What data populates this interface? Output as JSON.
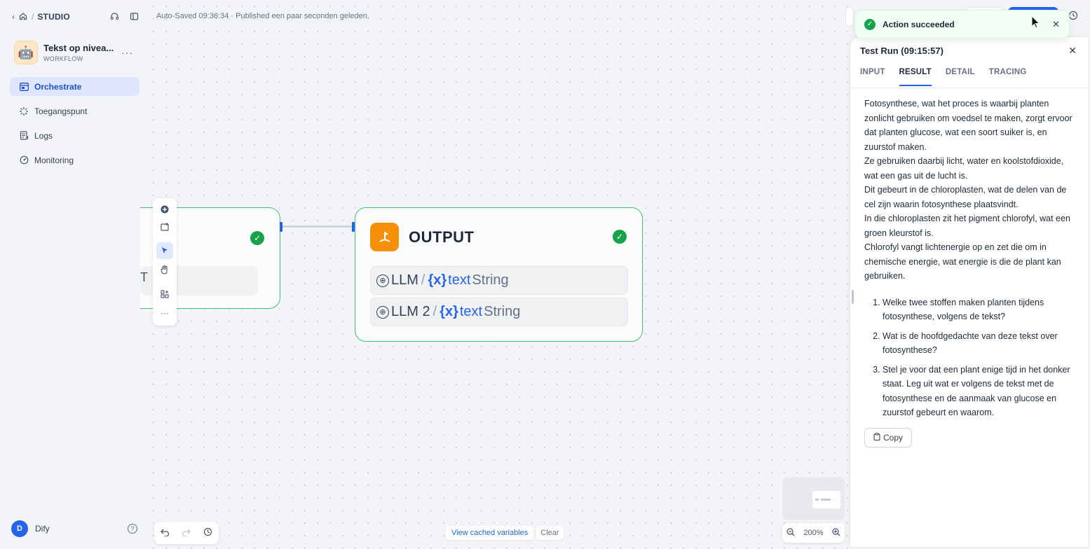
{
  "sidebar": {
    "breadcrumb": {
      "section": "STUDIO"
    },
    "app": {
      "name": "Tekst op nivea...",
      "type": "WORKFLOW",
      "emoji": "🤖"
    },
    "items": [
      {
        "label": "Orchestrate",
        "icon": "orchestrate-icon",
        "active": true
      },
      {
        "label": "Toegangspunt",
        "icon": "access-point-icon"
      },
      {
        "label": "Logs",
        "icon": "logs-icon"
      },
      {
        "label": "Monitoring",
        "icon": "monitoring-icon"
      }
    ],
    "user": {
      "initial": "D",
      "name": "Dify"
    }
  },
  "canvas": {
    "autosave": "Auto-Saved 09:36:34 · Published een paar seconden geleden.",
    "left_node": {
      "field_fragment": "T"
    },
    "output_node": {
      "title": "OUTPUT",
      "vars": [
        {
          "source": "LLM",
          "var_icon": "{x}",
          "name": "text",
          "type": "String"
        },
        {
          "source": "LLM 2",
          "var_icon": "{x}",
          "name": "text",
          "type": "String"
        }
      ]
    },
    "cached": {
      "view": "View cached variables",
      "clear": "Clear"
    },
    "zoom": {
      "level": "200%"
    }
  },
  "toast": {
    "message": "Action succeeded"
  },
  "panel": {
    "title": "Test Run (09:15:57)",
    "tabs": [
      {
        "label": "INPUT"
      },
      {
        "label": "RESULT",
        "active": true
      },
      {
        "label": "DETAIL"
      },
      {
        "label": "TRACING"
      }
    ],
    "paragraphs": [
      "Fotosynthese, wat het proces is waarbij planten zonlicht gebruiken om voedsel te maken, zorgt ervoor dat planten glucose, wat een soort suiker is, en zuurstof maken.",
      "Ze gebruiken daarbij licht, water en koolstofdioxide, wat een gas uit de lucht is.",
      "Dit gebeurt in de chloroplasten, wat de delen van de cel zijn waarin fotosynthese plaatsvindt.",
      "In die chloroplasten zit het pigment chlorofyl, wat een groen kleurstof is.",
      "Chlorofyl vangt lichtenergie op en zet die om in chemische energie, wat energie is die de plant kan gebruiken."
    ],
    "questions": [
      "Welke twee stoffen maken planten tijdens fotosynthese, volgens de tekst?",
      "Wat is de hoofdgedachte van deze tekst over fotosynthese?",
      "Stel je voor dat een plant enige tijd in het donker staat. Leg uit wat er volgens de tekst met de fotosynthese en de aanmaak van glucose en zuurstof gebeurt en waarom."
    ],
    "copy_label": "Copy"
  },
  "colors": {
    "accent": "#2563eb",
    "success": "#17a34a",
    "node_border": "#41c272",
    "output_icon": "#f79009"
  }
}
